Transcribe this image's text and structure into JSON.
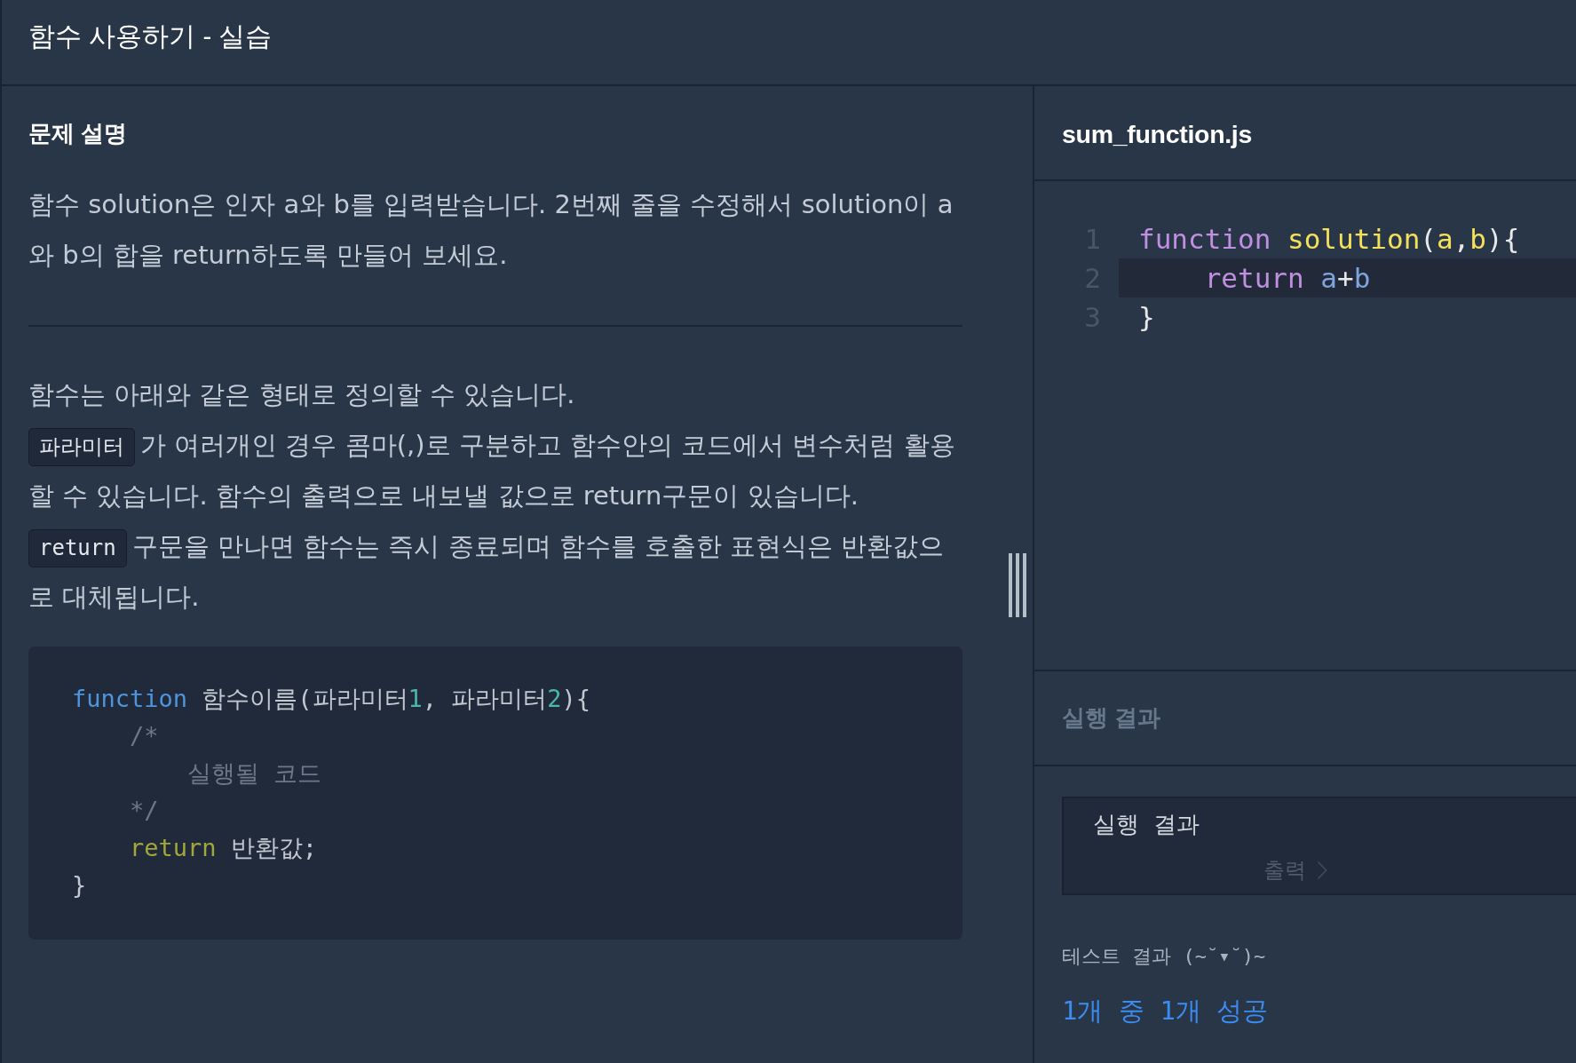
{
  "header": {
    "title": "함수 사용하기 - 실습"
  },
  "description": {
    "heading": "문제 설명",
    "intro": "함수 solution은 인자 a와 b를 입력받습니다. 2번째 줄을 수정해서 solution이 a와 b의 합을 return하도록 만들어 보세요.",
    "paragraphs": [
      {
        "segments": [
          {
            "kind": "text",
            "text": "함수는 아래와 같은 형태로 정의할 수 있습니다."
          }
        ]
      },
      {
        "segments": [
          {
            "kind": "code",
            "text": "파라미터"
          },
          {
            "kind": "text",
            "text": "가 여러개인 경우 콤마(,)로 구분하고 함수안의 코드에서 변수처럼 활용할 수 있습니다. 함수의 출력으로 내보낼 값으로 return구문이 있습니다."
          }
        ]
      },
      {
        "segments": [
          {
            "kind": "code",
            "text": "return"
          },
          {
            "kind": "text",
            "text": "구문을 만나면 함수는 즉시 종료되며 함수를 호출한 표현식은 반환값으로 대체됩니다."
          }
        ]
      }
    ],
    "example_code": [
      {
        "tokens": [
          {
            "kind": "keyword",
            "text": "function"
          },
          {
            "kind": "plain",
            "text": " 함수이름(파라미터"
          },
          {
            "kind": "number",
            "text": "1"
          },
          {
            "kind": "plain",
            "text": ", 파라미터"
          },
          {
            "kind": "number",
            "text": "2"
          },
          {
            "kind": "plain",
            "text": "){"
          }
        ]
      },
      {
        "tokens": [
          {
            "kind": "comment",
            "text": "    /*"
          }
        ]
      },
      {
        "tokens": [
          {
            "kind": "comment",
            "text": "        실행될 코드"
          }
        ]
      },
      {
        "tokens": [
          {
            "kind": "comment",
            "text": "    */"
          }
        ]
      },
      {
        "tokens": [
          {
            "kind": "control",
            "text": "    return"
          },
          {
            "kind": "plain",
            "text": " 반환값;"
          }
        ]
      },
      {
        "tokens": [
          {
            "kind": "plain",
            "text": "}"
          }
        ]
      }
    ]
  },
  "editor": {
    "filename": "sum_function.js",
    "lines": [
      {
        "number": "1",
        "active": false,
        "tokens": [
          {
            "kind": "keyword",
            "text": "function "
          },
          {
            "kind": "name",
            "text": "solution"
          },
          {
            "kind": "punct",
            "text": "("
          },
          {
            "kind": "param",
            "text": "a"
          },
          {
            "kind": "punct",
            "text": ","
          },
          {
            "kind": "param",
            "text": "b"
          },
          {
            "kind": "punct",
            "text": "){"
          }
        ]
      },
      {
        "number": "2",
        "active": true,
        "tokens": [
          {
            "kind": "keyword",
            "text": "    return "
          },
          {
            "kind": "variable",
            "text": "a"
          },
          {
            "kind": "operator",
            "text": "+"
          },
          {
            "kind": "variable",
            "text": "b"
          }
        ]
      },
      {
        "number": "3",
        "active": false,
        "tokens": [
          {
            "kind": "punct",
            "text": "}"
          }
        ]
      }
    ]
  },
  "run_result": {
    "heading": "실행 결과",
    "console": {
      "title": "실행 결과",
      "output_label": "출력"
    },
    "test_heading": "테스트 결과 (~˘▾˘)~",
    "summary": "1개 중 1개 성공"
  }
}
